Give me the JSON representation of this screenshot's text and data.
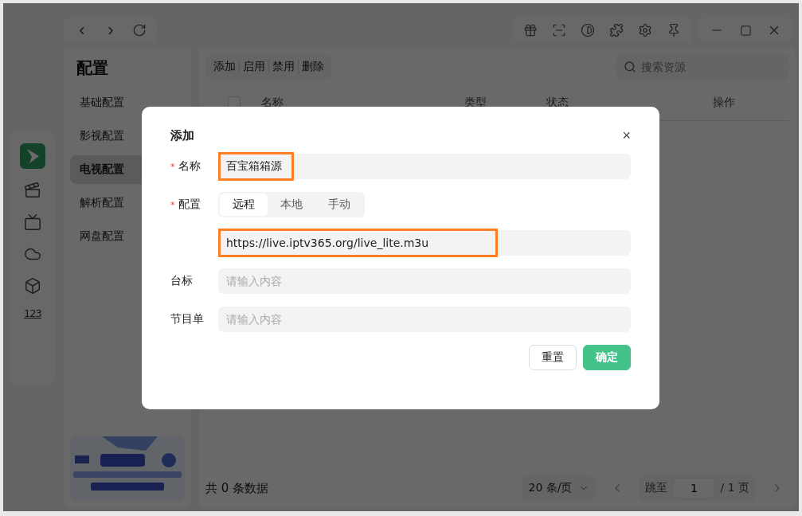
{
  "nav": {
    "back": "‹",
    "forward": "›"
  },
  "sidebar": {
    "title": "配置",
    "items": [
      {
        "label": "基础配置",
        "selected": false
      },
      {
        "label": "影视配置",
        "selected": false
      },
      {
        "label": "电视配置",
        "selected": true
      },
      {
        "label": "解析配置",
        "selected": false
      },
      {
        "label": "网盘配置",
        "selected": false
      }
    ]
  },
  "rail": {
    "digits_icon": "123"
  },
  "toolbar": {
    "actions": [
      "添加",
      "启用",
      "禁用",
      "删除"
    ],
    "search": {
      "placeholder": "搜索资源"
    }
  },
  "table": {
    "select_all": {
      "checked": false
    },
    "columns": [
      "名称",
      "类型",
      "状态",
      "操作"
    ]
  },
  "footer": {
    "total": "共 0 条数据",
    "page_size": "20 条/页",
    "jump_label": "跳至",
    "page": "1",
    "pages": "/ 1 页"
  },
  "dialog": {
    "title": "添加",
    "close": "×",
    "required_mark": "*",
    "fields": [
      {
        "kind": "input",
        "label": "名称",
        "required": true,
        "value": "百宝箱箱源",
        "highlighted": true
      },
      {
        "kind": "segmented",
        "label": "配置",
        "required": true,
        "options": [
          {
            "label": "远程",
            "selected": true
          },
          {
            "label": "本地",
            "selected": false
          },
          {
            "label": "手动",
            "selected": false
          }
        ]
      },
      {
        "kind": "input",
        "required": false,
        "value": "https://live.iptv365.org/live_lite.m3u",
        "highlighted": true
      },
      {
        "kind": "input",
        "label": "台标",
        "required": false,
        "placeholder": "请输入内容",
        "highlighted": false
      },
      {
        "kind": "input",
        "label": "节目单",
        "required": false,
        "placeholder": "请输入内容",
        "highlighted": false
      }
    ],
    "buttons": [
      {
        "label": "重置",
        "kind": "default"
      },
      {
        "label": "确定",
        "kind": "primary"
      }
    ]
  }
}
